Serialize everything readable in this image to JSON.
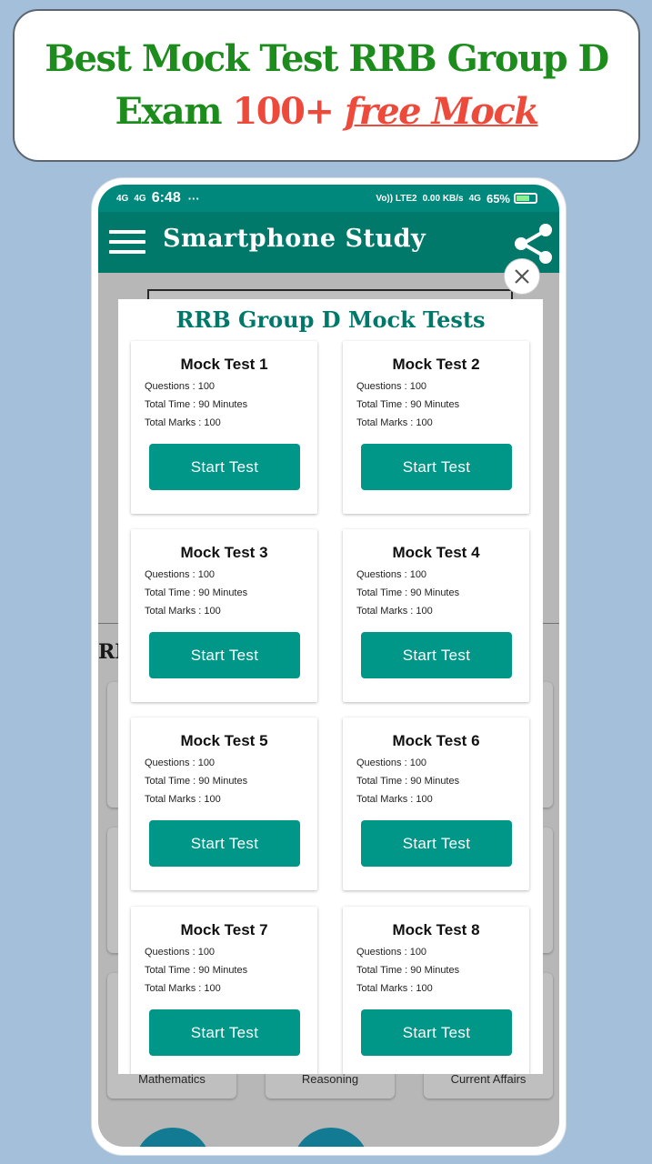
{
  "banner": {
    "line1": "Best Mock Test RRB Group D",
    "line2_prefix": "Exam ",
    "line2_number": "100+",
    "line2_free": "free Mock"
  },
  "statusbar": {
    "signal1": "4G",
    "signal2": "4G",
    "time": "6:48",
    "net_speed": "0.00",
    "net_unit": "KB/s",
    "volte": "Vo)) LTE2",
    "net_type": "4G",
    "battery": "65%"
  },
  "app": {
    "title": "Smartphone Study"
  },
  "background": {
    "section_label": "RR",
    "tile_labels": [
      "Mathematics",
      "Reasoning",
      "Current Affairs"
    ]
  },
  "dialog": {
    "title": "RRB Group D Mock Tests",
    "tests": [
      {
        "title": "Mock Test 1",
        "questions": "Questions : 100",
        "time": "Total Time : 90 Minutes",
        "marks": "Total Marks : 100",
        "button": "Start Test"
      },
      {
        "title": "Mock Test 2",
        "questions": "Questions : 100",
        "time": "Total Time : 90 Minutes",
        "marks": "Total Marks : 100",
        "button": "Start Test"
      },
      {
        "title": "Mock Test 3",
        "questions": "Questions : 100",
        "time": "Total Time : 90 Minutes",
        "marks": "Total Marks : 100",
        "button": "Start Test"
      },
      {
        "title": "Mock Test 4",
        "questions": "Questions : 100",
        "time": "Total Time : 90 Minutes",
        "marks": "Total Marks : 100",
        "button": "Start Test"
      },
      {
        "title": "Mock Test 5",
        "questions": "Questions : 100",
        "time": "Total Time : 90 Minutes",
        "marks": "Total Marks : 100",
        "button": "Start Test"
      },
      {
        "title": "Mock Test 6",
        "questions": "Questions : 100",
        "time": "Total Time : 90 Minutes",
        "marks": "Total Marks : 100",
        "button": "Start Test"
      },
      {
        "title": "Mock Test 7",
        "questions": "Questions : 100",
        "time": "Total Time : 90 Minutes",
        "marks": "Total Marks : 100",
        "button": "Start Test"
      },
      {
        "title": "Mock Test 8",
        "questions": "Questions : 100",
        "time": "Total Time : 90 Minutes",
        "marks": "Total Marks : 100",
        "button": "Start Test"
      }
    ]
  },
  "colors": {
    "primary": "#00796b",
    "statusbar": "#00887c",
    "button": "#009688",
    "banner_green": "#1c8c1c",
    "banner_red": "#ee4a3c",
    "background": "#a3bfd9"
  },
  "icons": {
    "menu": "hamburger-menu-icon",
    "share": "share-icon",
    "close": "close-icon"
  }
}
